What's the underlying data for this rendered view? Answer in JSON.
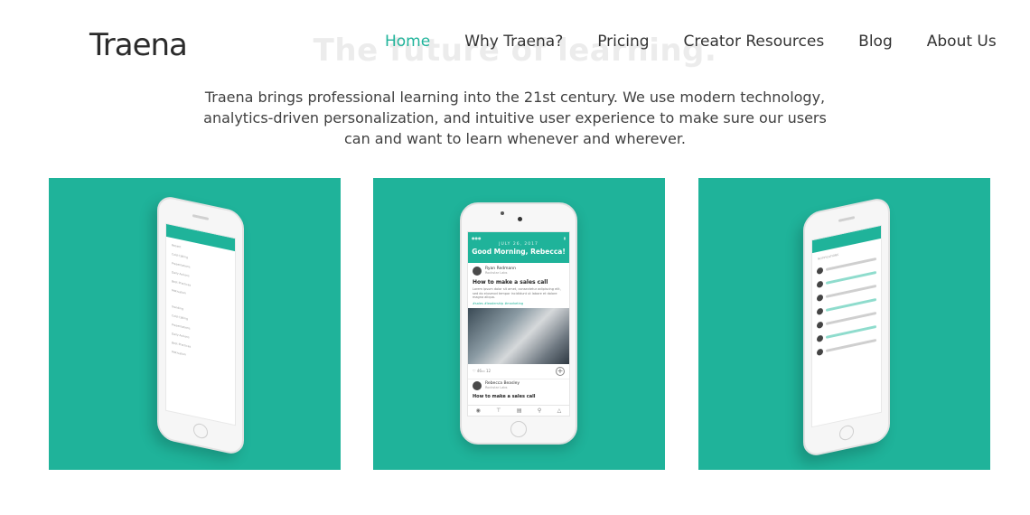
{
  "header": {
    "logo_text": "Traena",
    "nav": [
      "Home",
      "Why Traena?",
      "Pricing",
      "Creator Resources",
      "Blog",
      "About Us"
    ],
    "active_nav": "Home"
  },
  "hero": {
    "ghost_title": "The future of learning.",
    "intro": "Traena brings professional learning into the 21st century. We use modern technology, analytics-driven personalization, and intuitive user experience to make sure our users can and want to learn whenever and wherever."
  },
  "phone_center": {
    "date": "JULY 26, 2017",
    "greeting": "Good Morning, Rebecca!",
    "author_1": "Ryan Redmann",
    "author_1_role": "Rockstar Labs",
    "post_title": "How to make a sales call",
    "post_body": "Lorem ipsum dolor sit amet, consectetur adipiscing elit, sed do eiusmod tempor incididunt ut labore et dolore magna aliqua.",
    "tags": "#sales #leadership #marketing",
    "likes": "46",
    "comments": "12",
    "author_2": "Rebecca Beasley",
    "author_2_role": "Rockstar Labs",
    "post_2_title": "How to make a sales call"
  },
  "phone_left": {
    "sections": [
      "Recent",
      "Trending"
    ],
    "items": [
      "Cold Calling",
      "Presentations",
      "Daily Actions",
      "Best Practices",
      "Motivation"
    ]
  },
  "phone_right": {
    "header": "NOTIFICATIONS"
  },
  "colors": {
    "accent": "#1fb39a",
    "text": "#333333"
  }
}
